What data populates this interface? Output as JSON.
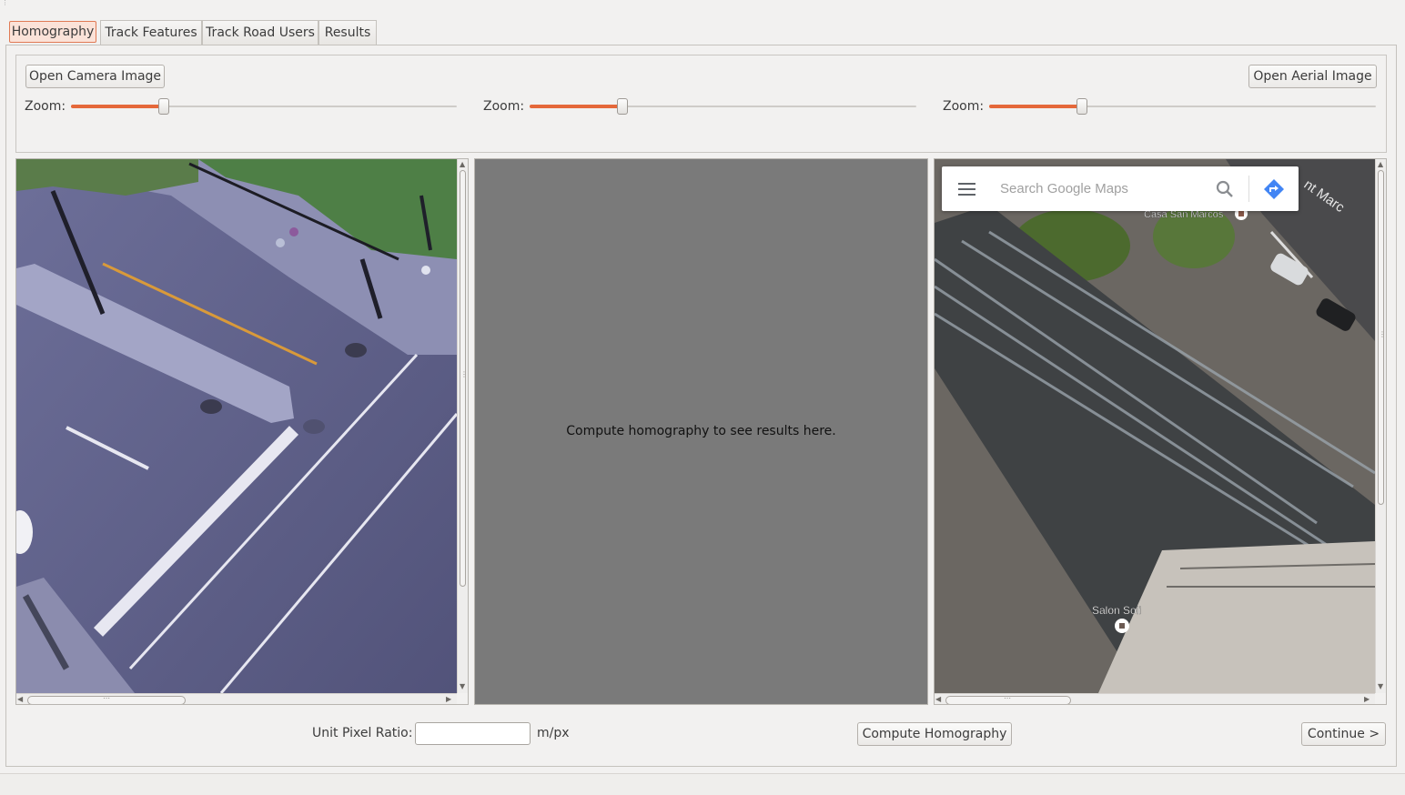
{
  "tabs": [
    {
      "label": "Homography",
      "active": true
    },
    {
      "label": "Track Features",
      "active": false
    },
    {
      "label": "Track Road Users",
      "active": false
    },
    {
      "label": "Results",
      "active": false
    }
  ],
  "toolbar": {
    "open_camera_label": "Open Camera Image",
    "open_aerial_label": "Open Aerial Image"
  },
  "zoom": {
    "label": "Zoom:",
    "sliders": [
      {
        "name": "camera",
        "value": 0.24
      },
      {
        "name": "result",
        "value": 0.24
      },
      {
        "name": "aerial",
        "value": 0.24
      }
    ]
  },
  "result_view": {
    "message": "Compute homography to see results here."
  },
  "aerial_map": {
    "search_placeholder": "Search Google Maps",
    "places": [
      "Casa San Marcos",
      "Salon Soli"
    ],
    "street_label": "nt Marc"
  },
  "footer": {
    "ratio_label": "Unit Pixel Ratio:",
    "ratio_value": "",
    "ratio_unit": "m/px",
    "compute_label": "Compute Homography",
    "continue_label": "Continue >"
  },
  "colors": {
    "accent": "#e5683a",
    "tab_active_bg": "#fbe2d8",
    "result_bg": "#7a7a7a"
  }
}
